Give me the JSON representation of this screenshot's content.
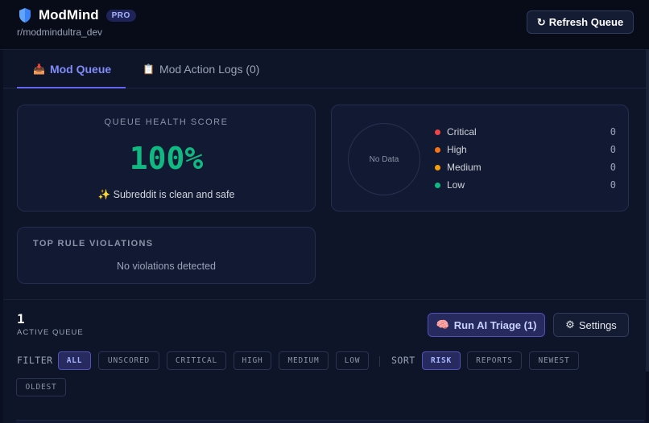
{
  "header": {
    "app_name": "ModMind",
    "badge": "PRO",
    "subreddit": "r/modmindultra_dev",
    "refresh_label": "Refresh Queue"
  },
  "tabs": [
    {
      "label": "Mod Queue",
      "icon": "inbox-tray-icon",
      "active": true
    },
    {
      "label": "Mod Action Logs (0)",
      "icon": "clipboard-icon",
      "active": false
    }
  ],
  "health": {
    "title": "QUEUE HEALTH SCORE",
    "score": "100%",
    "message": "✨ Subreddit is clean and safe"
  },
  "risk_chart": {
    "empty_label": "No Data",
    "legend": [
      {
        "label": "Critical",
        "count": "0",
        "color": "#ef4444"
      },
      {
        "label": "High",
        "count": "0",
        "color": "#f97316"
      },
      {
        "label": "Medium",
        "count": "0",
        "color": "#f59e0b"
      },
      {
        "label": "Low",
        "count": "0",
        "color": "#10b981"
      }
    ]
  },
  "violations": {
    "title": "TOP RULE VIOLATIONS",
    "empty": "No violations detected"
  },
  "queue": {
    "active_count": "1",
    "active_label": "ACTIVE QUEUE",
    "triage_label": "Run AI Triage (1)",
    "settings_label": "Settings"
  },
  "filter": {
    "label": "FILTER",
    "options": [
      "ALL",
      "UNSCORED",
      "CRITICAL",
      "HIGH",
      "MEDIUM",
      "LOW"
    ],
    "selected": "ALL"
  },
  "sort": {
    "label": "SORT",
    "options": [
      "RISK",
      "REPORTS",
      "NEWEST",
      "OLDEST"
    ],
    "selected": "RISK"
  },
  "colors": {
    "accent": "#6366f1",
    "health_good": "#10b981"
  }
}
